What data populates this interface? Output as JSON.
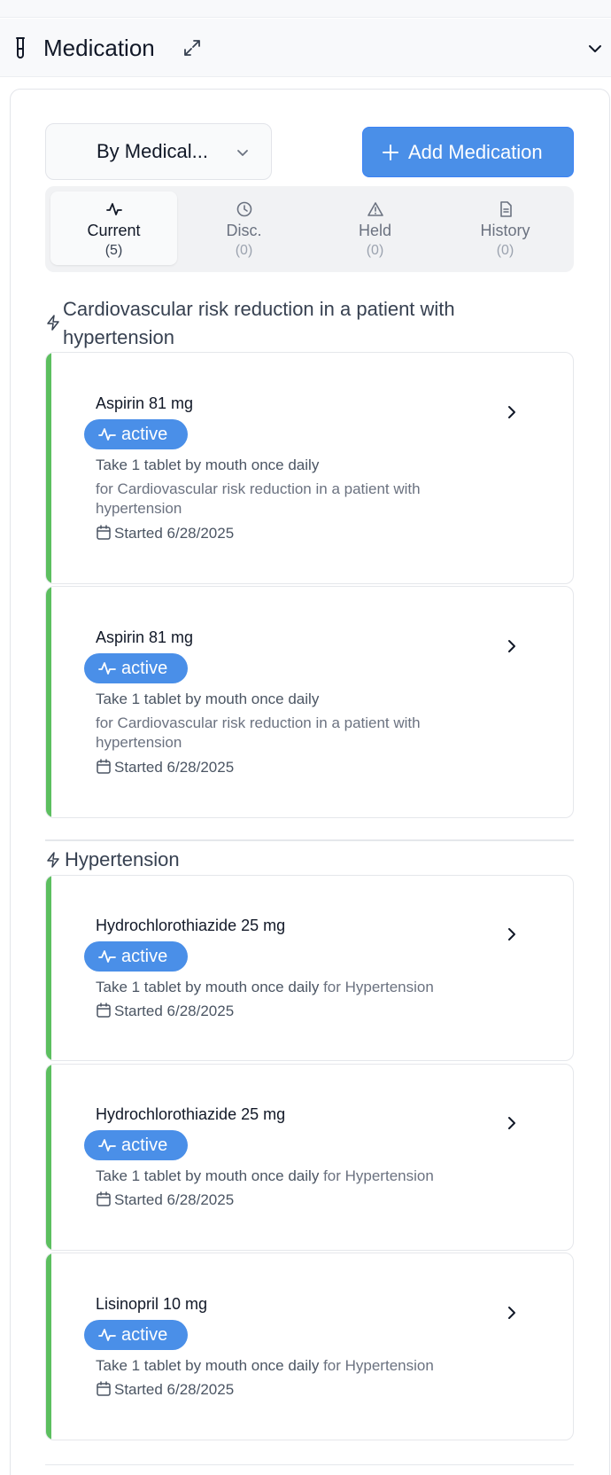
{
  "section": {
    "title": "Medication",
    "icons": {
      "section": "flask-icon",
      "expand": "expand-icon",
      "collapse": "chevron-down-icon"
    }
  },
  "toolbar": {
    "group_by_label": "By Medical...",
    "add_label": "Add Medication"
  },
  "tabs": [
    {
      "name": "Current",
      "count": "(5)",
      "icon": "activity-icon",
      "active": true
    },
    {
      "name": "Disc.",
      "count": "(0)",
      "icon": "clock-icon",
      "active": false
    },
    {
      "name": "Held",
      "count": "(0)",
      "icon": "warning-icon",
      "active": false
    },
    {
      "name": "History",
      "count": "(0)",
      "icon": "document-icon",
      "active": false
    }
  ],
  "groups": [
    {
      "heading_line1": "Cardiovascular risk reduction in a patient with",
      "heading_line2": "hypertension",
      "items": [
        {
          "name": "Aspirin 81 mg",
          "status": "active",
          "instruction": "Take 1 tablet by mouth once daily",
          "reason_line1": "for Cardiovascular risk reduction in a patient with",
          "reason_line2": "hypertension",
          "started": "Started 6/28/2025"
        },
        {
          "name": "Aspirin 81 mg",
          "status": "active",
          "instruction": "Take 1 tablet by mouth once daily",
          "reason_line1": "for Cardiovascular risk reduction in a patient with",
          "reason_line2": "hypertension",
          "started": "Started 6/28/2025"
        }
      ]
    },
    {
      "heading_line1": "Hypertension",
      "items": [
        {
          "name": "Hydrochlorothiazide 25 mg",
          "status": "active",
          "instruction": "Take 1 tablet by mouth once daily",
          "reason_inline": "for Hypertension",
          "started": "Started 6/28/2025"
        },
        {
          "name": "Hydrochlorothiazide 25 mg",
          "status": "active",
          "instruction": "Take 1 tablet by mouth once daily",
          "reason_inline": "for Hypertension",
          "started": "Started 6/28/2025"
        },
        {
          "name": "Lisinopril 10 mg",
          "status": "active",
          "instruction": "Take 1 tablet by mouth once daily",
          "reason_inline": "for Hypertension",
          "started": "Started 6/28/2025"
        }
      ]
    }
  ],
  "colors": {
    "accent": "#4a8fe8",
    "active_bar": "#5cbf5f"
  }
}
